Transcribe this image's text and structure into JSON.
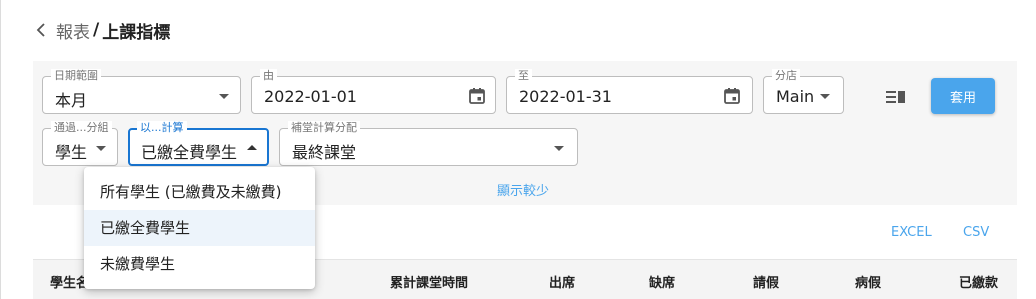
{
  "breadcrumb": {
    "parent": "報表",
    "separator": "/",
    "current": "上課指標"
  },
  "filters": {
    "date_range": {
      "label": "日期範圍",
      "value": "本月"
    },
    "from": {
      "label": "由",
      "value": "2022-01-01"
    },
    "to": {
      "label": "至",
      "value": "2022-01-31"
    },
    "branch": {
      "label": "分店",
      "value": "Main"
    },
    "group_by": {
      "label": "通過...分組",
      "value": "學生"
    },
    "calc_by": {
      "label": "以...計算",
      "value": "已繳全費學生"
    },
    "makeup_allocation": {
      "label": "補堂計算分配",
      "value": "最終課堂"
    }
  },
  "apply_label": "套用",
  "show_less_label": "顯示較少",
  "exports": {
    "excel": "EXCEL",
    "csv": "CSV"
  },
  "table": {
    "columns": [
      "學生名",
      "累計課堂時間",
      "出席",
      "缺席",
      "請假",
      "病假",
      "已繳款"
    ]
  },
  "dropdown": {
    "options": [
      "所有學生 (已繳費及未繳費)",
      "已繳全費學生",
      "未繳費學生"
    ],
    "selected_index": 1
  },
  "colors": {
    "accent": "#4aa5ec",
    "focus": "#1976d2",
    "panel": "#f6f6f6"
  },
  "icons": [
    "chevron-left-icon",
    "calendar-icon",
    "columns-icon",
    "dropdown-arrow-icon"
  ]
}
